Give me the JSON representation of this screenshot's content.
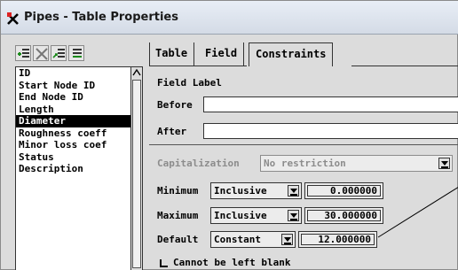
{
  "window": {
    "title": "Pipes - Table Properties",
    "icon": "pipes-app-icon"
  },
  "toolbar": {
    "buttons": [
      "add-field-icon",
      "delete-field-icon",
      "import-field-icon",
      "edit-field-icon"
    ]
  },
  "field_list": {
    "items": [
      {
        "label": "ID",
        "selected": false
      },
      {
        "label": "Start Node ID",
        "selected": false
      },
      {
        "label": "End Node ID",
        "selected": false
      },
      {
        "label": "Length",
        "selected": false
      },
      {
        "label": "Diameter",
        "selected": true
      },
      {
        "label": "Roughness coeff",
        "selected": false
      },
      {
        "label": "Minor loss coef",
        "selected": false
      },
      {
        "label": "Status",
        "selected": false
      },
      {
        "label": "Description",
        "selected": false
      }
    ]
  },
  "tabs": [
    {
      "label": "Table",
      "active": false
    },
    {
      "label": "Field",
      "active": false
    },
    {
      "label": "Constraints",
      "active": true
    }
  ],
  "constraints": {
    "field_label_heading": "Field Label",
    "before_label": "Before",
    "before_value": "",
    "after_label": "After",
    "after_value": "",
    "capitalization_label": "Capitalization",
    "capitalization_value": "No restriction",
    "minimum_label": "Minimum",
    "minimum_mode": "Inclusive",
    "minimum_value": "0.000000",
    "maximum_label": "Maximum",
    "maximum_mode": "Inclusive",
    "maximum_value": "30.000000",
    "default_label": "Default",
    "default_mode": "Constant",
    "default_value": "12.000000",
    "cannot_be_blank_label": "Cannot be left blank",
    "cannot_be_blank_checked": false
  }
}
